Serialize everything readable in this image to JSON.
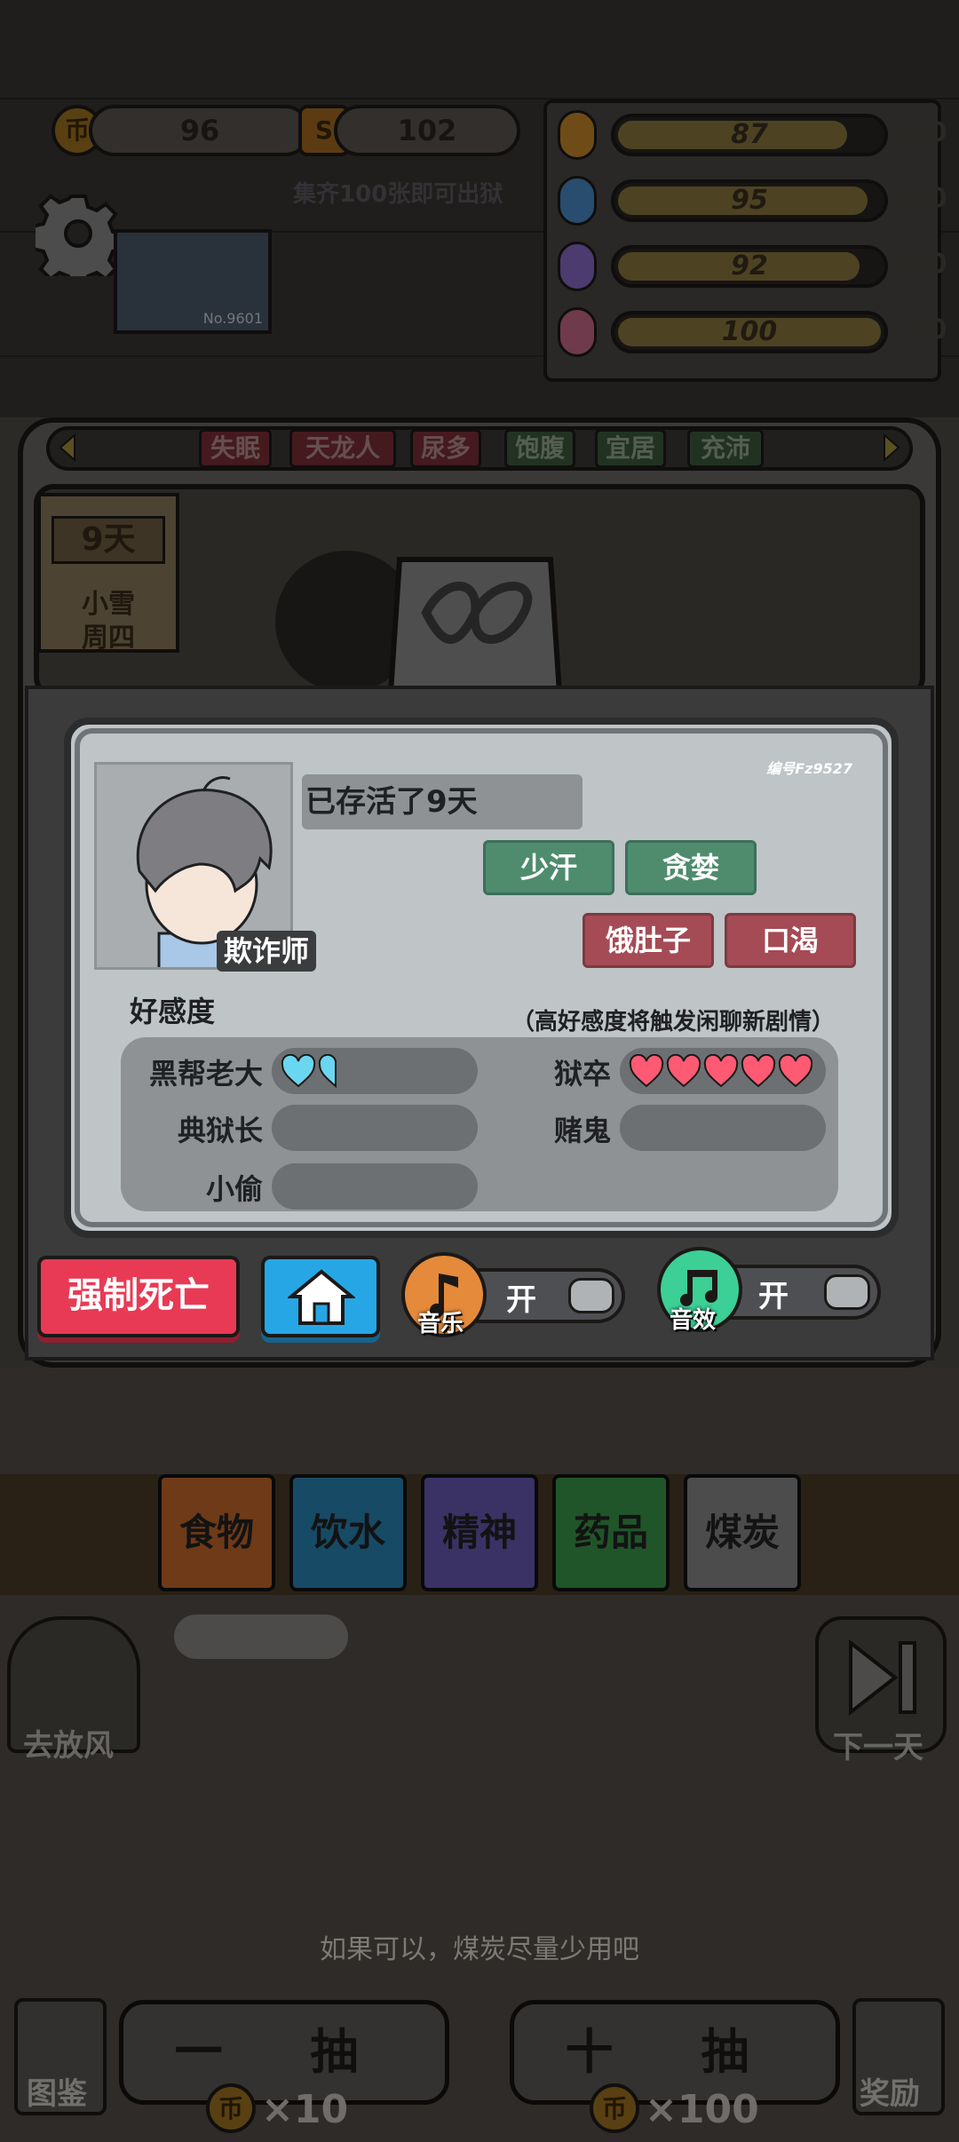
{
  "top": {
    "coins": "96",
    "tickets": "102",
    "collect_hint": "集齐100张即可出狱",
    "stats": [
      {
        "icon": "energy-icon",
        "value": "87",
        "fill": 0.87,
        "max": "100"
      },
      {
        "icon": "water-drop-icon",
        "value": "95",
        "fill": 0.95,
        "max": "100"
      },
      {
        "icon": "brain-icon",
        "value": "92",
        "fill": 0.92,
        "max": "100"
      },
      {
        "icon": "thermometer-icon",
        "value": "100",
        "fill": 1.0,
        "max": "100"
      }
    ],
    "prisoner_no": "No.9601"
  },
  "tags": [
    "失眠",
    "天龙人",
    "尿多",
    "饱腹",
    "宜居",
    "充沛"
  ],
  "calendar": {
    "days": "9天",
    "weather": "小雪",
    "weekday": "周四"
  },
  "card": {
    "serial": "编号Fz9527",
    "survived": "已存活了9天",
    "role": "欺诈师",
    "traits": [
      "少汗",
      "贪婪"
    ],
    "status": [
      "饿肚子",
      "口渴"
    ],
    "affinity_title": "好感度",
    "affinity_hint": "（高好感度将触发闲聊新剧情）",
    "affinity": [
      {
        "name": "黑帮老大",
        "hearts": 1.5
      },
      {
        "name": "狱卒",
        "hearts": 5
      },
      {
        "name": "典狱长",
        "hearts": 0
      },
      {
        "name": "赌鬼",
        "hearts": 0
      },
      {
        "name": "小偷",
        "hearts": 0
      }
    ]
  },
  "controls": {
    "force_death": "强制死亡",
    "music_label": "音乐",
    "music_state": "开",
    "sfx_label": "音效",
    "sfx_state": "开"
  },
  "categories": [
    "食物",
    "饮水",
    "精神",
    "药品",
    "煤炭"
  ],
  "side": {
    "left": "去放风",
    "right": "下一天"
  },
  "tip": "如果可以，煤炭尽量少用吧",
  "draw": {
    "one": "一 抽",
    "ten": "十 抽",
    "one_cost": "×10",
    "ten_cost": "×100",
    "handbook": "图鉴",
    "reward": "奖励"
  },
  "colors": {
    "force_red": "#e83a55",
    "home_blue": "#27a6e6",
    "heart": "#ff5a73",
    "heart_blue": "#6bd6f0",
    "trait_green": "#4f8c6e",
    "status_red": "#a54b55"
  }
}
